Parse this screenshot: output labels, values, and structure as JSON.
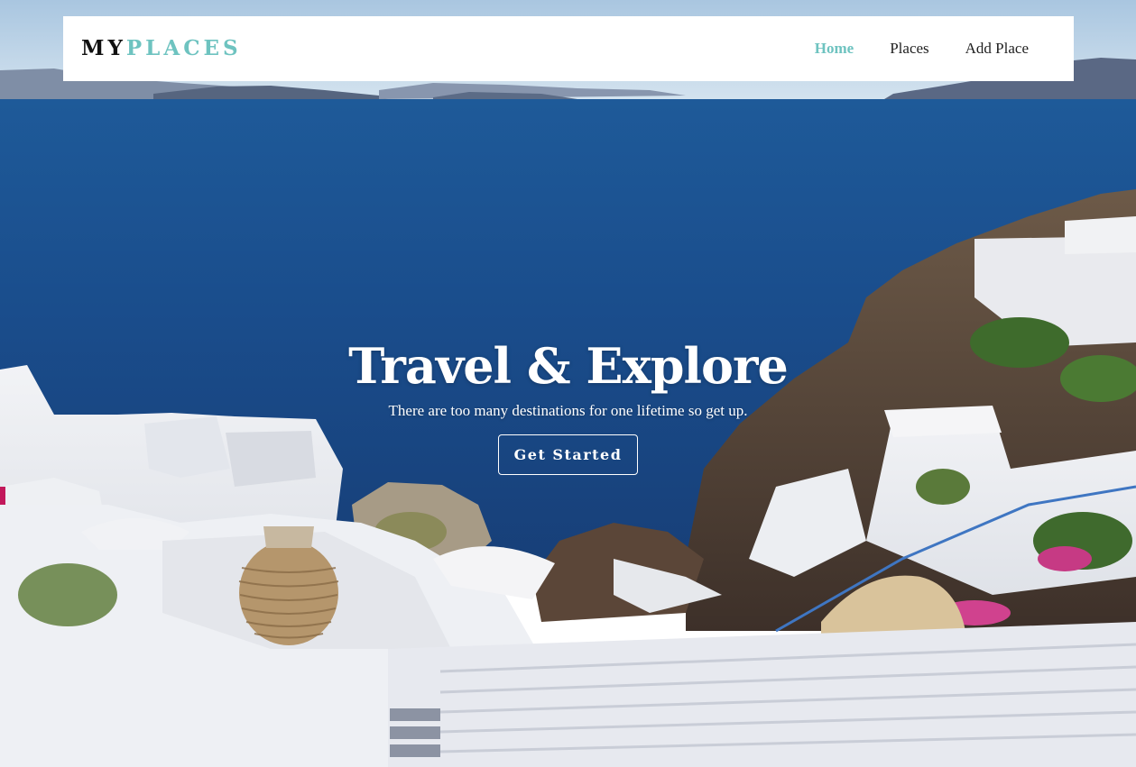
{
  "brand": {
    "logo_part1": "MY",
    "logo_part2": "PLACES"
  },
  "nav": {
    "items": [
      {
        "label": "Home",
        "active": true
      },
      {
        "label": "Places",
        "active": false
      },
      {
        "label": "Add Place",
        "active": false
      }
    ]
  },
  "hero": {
    "title": "Travel & Explore",
    "subtitle": "There are too many destinations for one lifetime so get up.",
    "cta_label": "Get Started"
  },
  "colors": {
    "accent": "#6ec3c0",
    "nav_bg": "#ffffff",
    "sea": "#1c4f8f",
    "sky": "#b9d3e8"
  }
}
